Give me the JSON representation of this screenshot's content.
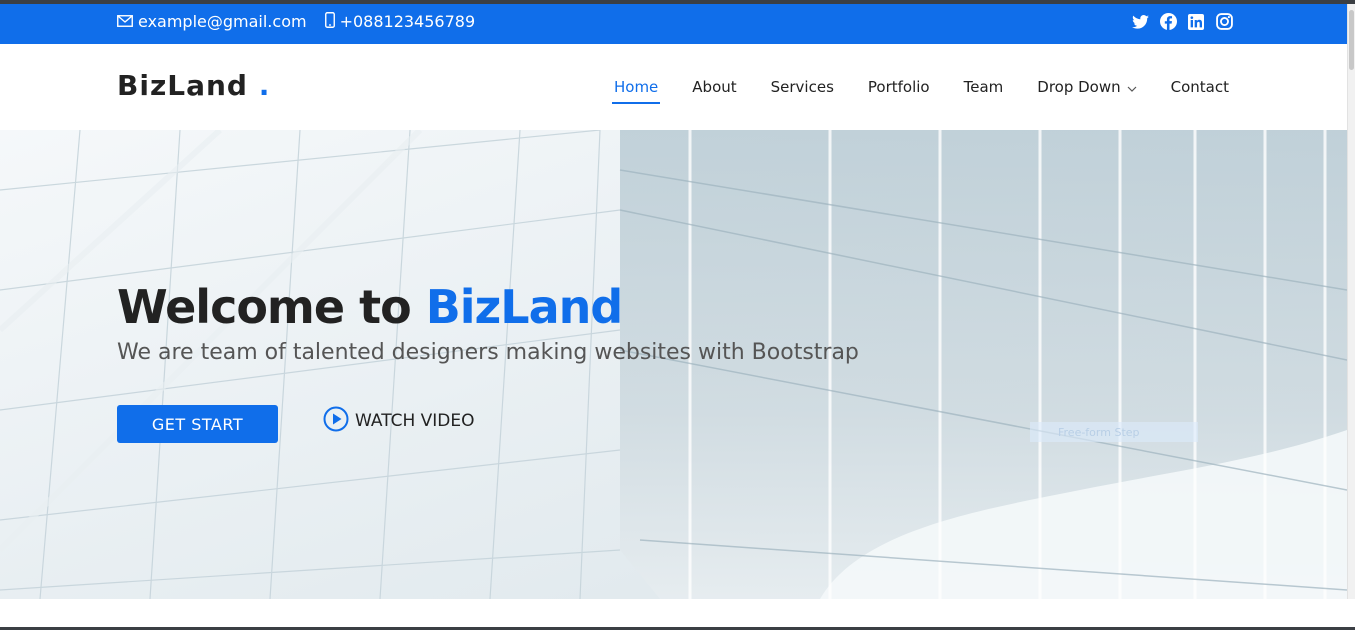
{
  "topbar": {
    "email": "example@gmail.com",
    "phone": "+088123456789",
    "social": [
      "twitter-icon",
      "facebook-icon",
      "linkedin-icon",
      "instagram-icon"
    ],
    "bg_color": "#106eea"
  },
  "header": {
    "logo": "BizLand",
    "logo_dot": ".",
    "nav": [
      {
        "label": "Home",
        "active": true
      },
      {
        "label": "About"
      },
      {
        "label": "Services"
      },
      {
        "label": "Portfolio"
      },
      {
        "label": "Team"
      },
      {
        "label": "Drop Down",
        "has_dropdown": true
      },
      {
        "label": "Contact"
      }
    ]
  },
  "hero": {
    "title_prefix": "Welcome to",
    "title_accent": "BizLand",
    "subtitle": "We are team of talented designers making websites with Bootstrap",
    "primary_button": "GET START",
    "secondary_button": "WATCH VIDEO",
    "faint_tag": "Free-form Step"
  },
  "colors": {
    "accent": "#106eea",
    "text_dark": "#222222",
    "text_muted": "#555555"
  }
}
